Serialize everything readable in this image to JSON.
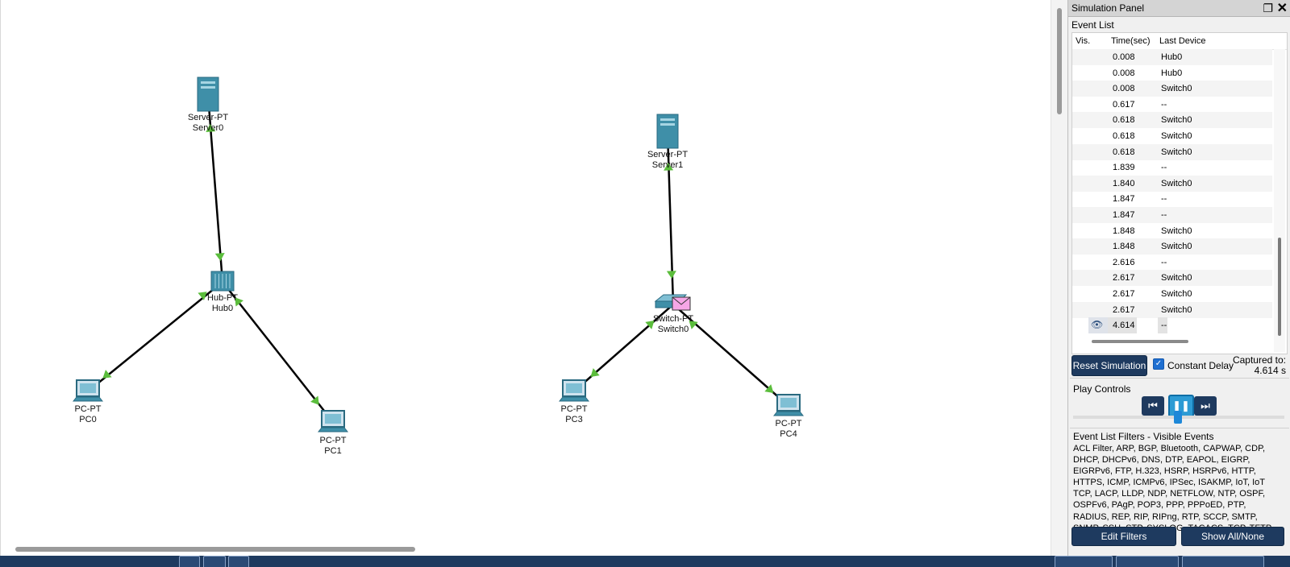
{
  "topology": {
    "devices": [
      {
        "id": "server0",
        "type": "Server-PT",
        "name": "Server0",
        "kind": "server"
      },
      {
        "id": "hub0",
        "type": "Hub-PT",
        "name": "Hub0",
        "kind": "hub"
      },
      {
        "id": "pc0",
        "type": "PC-PT",
        "name": "PC0",
        "kind": "pc"
      },
      {
        "id": "pc1",
        "type": "PC-PT",
        "name": "PC1",
        "kind": "pc"
      },
      {
        "id": "server1",
        "type": "Server-PT",
        "name": "Server1",
        "kind": "server"
      },
      {
        "id": "switch0",
        "type": "Switch-PT",
        "name": "Switch0",
        "kind": "switch"
      },
      {
        "id": "pc3",
        "type": "PC-PT",
        "name": "PC3",
        "kind": "pc"
      },
      {
        "id": "pc4",
        "type": "PC-PT",
        "name": "PC4",
        "kind": "pc"
      }
    ],
    "link_color": "#000000",
    "port_indicator_color": "#5bbd3c"
  },
  "sim_panel": {
    "title": "Simulation Panel",
    "event_list_label": "Event List",
    "columns": {
      "vis": "Vis.",
      "time": "Time(sec)",
      "device": "Last Device"
    },
    "events": [
      {
        "time": "0.008",
        "device": "Hub0"
      },
      {
        "time": "0.008",
        "device": "Hub0"
      },
      {
        "time": "0.008",
        "device": "Switch0"
      },
      {
        "time": "0.617",
        "device": "--"
      },
      {
        "time": "0.618",
        "device": "Switch0"
      },
      {
        "time": "0.618",
        "device": "Switch0"
      },
      {
        "time": "0.618",
        "device": "Switch0"
      },
      {
        "time": "1.839",
        "device": "--"
      },
      {
        "time": "1.840",
        "device": "Switch0"
      },
      {
        "time": "1.847",
        "device": "--"
      },
      {
        "time": "1.847",
        "device": "--"
      },
      {
        "time": "1.848",
        "device": "Switch0"
      },
      {
        "time": "1.848",
        "device": "Switch0"
      },
      {
        "time": "2.616",
        "device": "--"
      },
      {
        "time": "2.617",
        "device": "Switch0"
      },
      {
        "time": "2.617",
        "device": "Switch0"
      },
      {
        "time": "2.617",
        "device": "Switch0"
      },
      {
        "time": "4.614",
        "device": "--",
        "current": true
      }
    ],
    "reset_label": "Reset Simulation",
    "constant_delay_label": "Constant Delay",
    "constant_delay_checked": true,
    "captured_label": "Captured to:",
    "captured_value": "4.614 s",
    "play_controls_label": "Play Controls",
    "filters_title": "Event List Filters - Visible Events",
    "filters_text": "ACL Filter, ARP, BGP, Bluetooth, CAPWAP, CDP, DHCP, DHCPv6, DNS, DTP, EAPOL, EIGRP, EIGRPv6, FTP, H.323, HSRP, HSRPv6, HTTP, HTTPS, ICMP, ICMPv6, IPSec, ISAKMP, IoT, IoT TCP, LACP, LLDP, NDP, NETFLOW, NTP, OSPF, OSPFv6, PAgP, POP3, PPP, PPPoED, PTP, RADIUS, REP, RIP, RIPng, RTP, SCCP, SMTP, SNMP, SSH, STP, SYSLOG, TACACS, TCP, TFTP, Telnet, UDP, USB, VTP",
    "edit_filters_label": "Edit Filters",
    "show_all_label": "Show All/None"
  },
  "colors": {
    "navy": "#1e3a5f",
    "accent_blue": "#2d9bd4",
    "device_teal": "#3f8fa8"
  }
}
